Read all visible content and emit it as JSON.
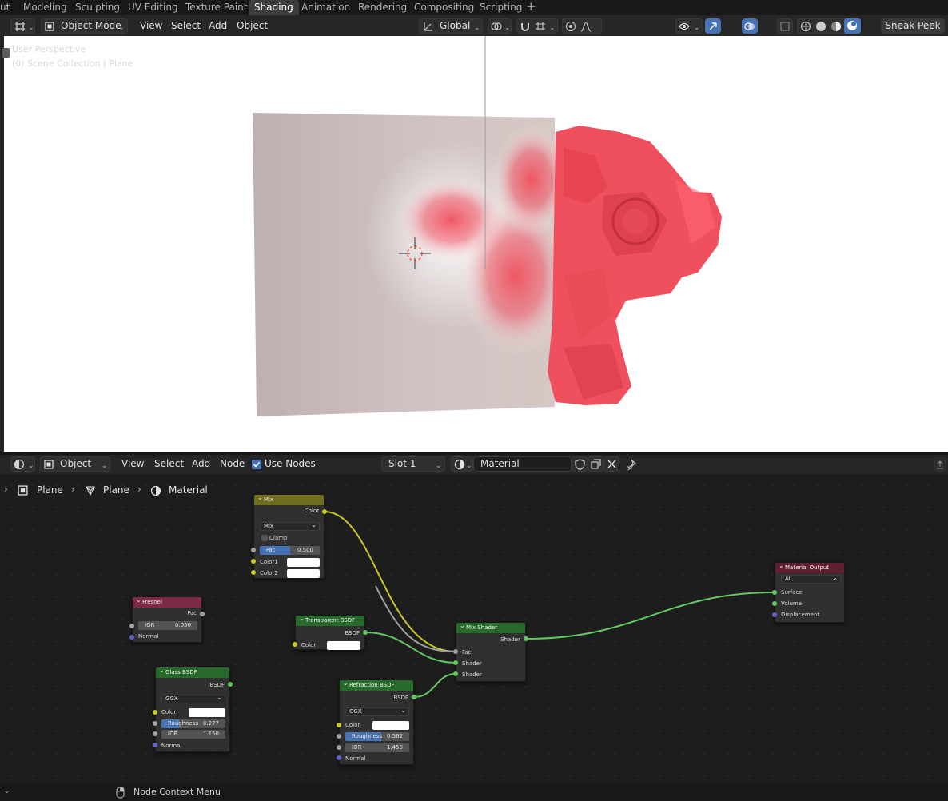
{
  "workspace_tabs": [
    "ut",
    "Modeling",
    "Sculpting",
    "UV Editing",
    "Texture Paint",
    "Shading",
    "Animation",
    "Rendering",
    "Compositing",
    "Scripting",
    "+"
  ],
  "viewport_header": {
    "mode": "Object Mode",
    "menus": [
      "View",
      "Select",
      "Add",
      "Object"
    ],
    "transform": "Global",
    "sneak_peek": "Sneak Peek"
  },
  "viewport": {
    "overlay_line1": "User Perspective",
    "overlay_line2": "(0) Scene Collection | Plane"
  },
  "node_header": {
    "mode": "Object",
    "menus": [
      "View",
      "Select",
      "Add",
      "Node"
    ],
    "use_nodes": "Use Nodes",
    "slot": "Slot 1",
    "material": "Material"
  },
  "breadcrumb": [
    "Plane",
    "Plane",
    "Material"
  ],
  "nodes": {
    "mix": {
      "title": "Mix",
      "out_color": "Color",
      "blend": "Mix",
      "clamp": "Clamp",
      "fac_label": "Fac",
      "fac_value": "0.500",
      "fac_fraction": 0.5,
      "color1": "Color1",
      "color2": "Color2"
    },
    "fresnel": {
      "title": "Fresnel",
      "out_fac": "Fac",
      "ior_label": "IOR",
      "ior_value": "0.050",
      "normal": "Normal"
    },
    "glass": {
      "title": "Glass BSDF",
      "out": "BSDF",
      "dist": "GGX",
      "color": "Color",
      "rough_label": "Roughness",
      "rough_value": "0.277",
      "rough_fraction": 0.277,
      "ior_label": "IOR",
      "ior_value": "1.150",
      "normal": "Normal"
    },
    "transparent": {
      "title": "Transparent BSDF",
      "out": "BSDF",
      "color": "Color"
    },
    "refraction": {
      "title": "Refraction BSDF",
      "out": "BSDF",
      "dist": "GGX",
      "color": "Color",
      "rough_label": "Roughness",
      "rough_value": "0.562",
      "rough_fraction": 0.562,
      "ior_label": "IOR",
      "ior_value": "1.450",
      "normal": "Normal"
    },
    "mixshader": {
      "title": "Mix Shader",
      "out": "Shader",
      "fac": "Fac",
      "shader1": "Shader",
      "shader2": "Shader"
    },
    "output": {
      "title": "Material Output",
      "target": "All",
      "surface": "Surface",
      "volume": "Volume",
      "displacement": "Displacement"
    }
  },
  "status": {
    "context_menu": "Node Context Menu"
  },
  "colors": {
    "accent": "#4772b3",
    "socket_shader": "#63c763",
    "socket_color": "#c7c729",
    "socket_float": "#a1a1a1",
    "socket_vector": "#6363c7",
    "header_mix": "#6e6e1e",
    "header_fresnel": "#7c2a46",
    "header_shader": "#276a2c",
    "header_output": "#5f1f2f",
    "mesh_red": "#f0505d"
  }
}
